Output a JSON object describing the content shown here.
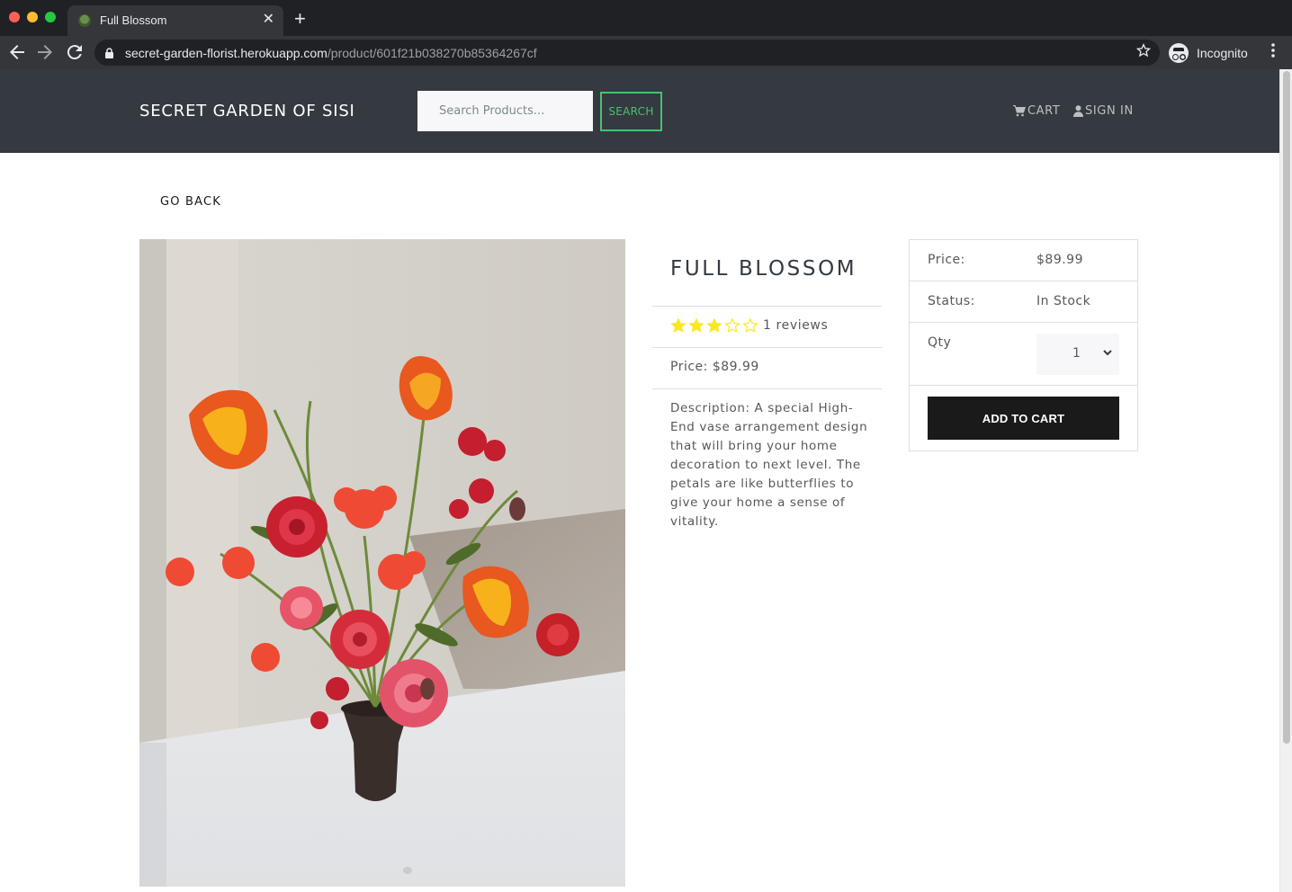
{
  "browser": {
    "tab_title": "Full Blossom",
    "tab_close": "✕",
    "new_tab": "+",
    "url_host": "secret-garden-florist.herokuapp.com",
    "url_path": "/product/601f21b038270b85364267cf",
    "profile_label": "Incognito"
  },
  "header": {
    "brand": "SECRET GARDEN OF SISI",
    "search_placeholder": "Search Products...",
    "search_button": "Search",
    "cart_label": "CART",
    "signin_label": "SIGN IN"
  },
  "page": {
    "go_back": "GO BACK"
  },
  "product": {
    "title": "FULL BLOSSOM",
    "rating": 3,
    "rating_max": 5,
    "reviews_text": "1 reviews",
    "price_line": "Price: $89.99",
    "description": "Description: A special High-End vase arrangement design that will bring your home decoration to next level. The petals are like butterflies to give your home a sense of vitality."
  },
  "purchase": {
    "price_label": "Price:",
    "price_value": "$89.99",
    "status_label": "Status:",
    "status_value": "In Stock",
    "qty_label": "Qty",
    "qty_value": "1",
    "add_button": "Add To Cart"
  },
  "colors": {
    "header_bg": "#343a40",
    "accent_green": "#4bbf73",
    "star_yellow": "#f8e825",
    "button_dark": "#1a1a1a"
  }
}
